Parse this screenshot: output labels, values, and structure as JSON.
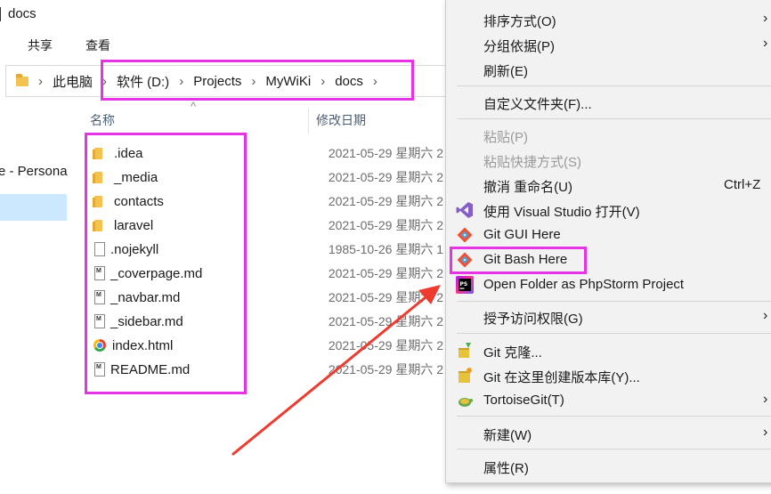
{
  "window": {
    "title": "docs"
  },
  "ribbon": {
    "tabs": [
      "共享",
      "查看"
    ]
  },
  "address": {
    "this_pc": "此电脑",
    "drive": "软件 (D:)",
    "folder1": "Projects",
    "folder2": "MyWiKi",
    "folder3": "docs",
    "separator": "›"
  },
  "sidebar": {
    "truncated_label": "e - Persona"
  },
  "columns": {
    "name": "名称",
    "date": "修改日期",
    "sort_indicator": "^"
  },
  "files": [
    {
      "name": ".idea",
      "icon": "folder-icon",
      "date": "2021-05-29 星期六 2"
    },
    {
      "name": "_media",
      "icon": "folder-icon",
      "date": "2021-05-29 星期六 2"
    },
    {
      "name": "contacts",
      "icon": "folder-icon",
      "date": "2021-05-29 星期六 2"
    },
    {
      "name": "laravel",
      "icon": "folder-icon",
      "date": "2021-05-29 星期六 2"
    },
    {
      "name": ".nojekyll",
      "icon": "file-icon",
      "date": "1985-10-26 星期六 1"
    },
    {
      "name": "_coverpage.md",
      "icon": "markdown-file-icon",
      "date": "2021-05-29 星期六 2"
    },
    {
      "name": "_navbar.md",
      "icon": "markdown-file-icon",
      "date": "2021-05-29 星期六 2"
    },
    {
      "name": "_sidebar.md",
      "icon": "markdown-file-icon",
      "date": "2021-05-29 星期六 2"
    },
    {
      "name": "index.html",
      "icon": "chrome-html-icon",
      "date": "2021-05-29 星期六 2"
    },
    {
      "name": "README.md",
      "icon": "markdown-file-icon",
      "date": "2021-05-29 星期六 2"
    }
  ],
  "menu": {
    "sort_by": "排序方式(O)",
    "group_by": "分组依据(P)",
    "refresh": "刷新(E)",
    "customize_folder": "自定义文件夹(F)...",
    "paste": "粘贴(P)",
    "paste_shortcut": "粘贴快捷方式(S)",
    "undo_rename": "撤消 重命名(U)",
    "undo_shortcut": "Ctrl+Z",
    "open_with_vs": "使用 Visual Studio 打开(V)",
    "git_gui_here": "Git GUI Here",
    "git_bash_here": "Git Bash Here",
    "open_phpstorm": "Open Folder as PhpStorm Project",
    "grant_access": "授予访问权限(G)",
    "git_clone": "Git 克隆...",
    "git_create_repo": "Git 在这里创建版本库(Y)...",
    "tortoisegit": "TortoiseGit(T)",
    "new": "新建(W)",
    "properties": "属性(R)",
    "submenu_arrow": "›"
  },
  "colors": {
    "highlight": "#e533e5",
    "arrow": "#ee3b30",
    "selection": "#cce8ff",
    "menu_bg": "#f2f2f2"
  }
}
